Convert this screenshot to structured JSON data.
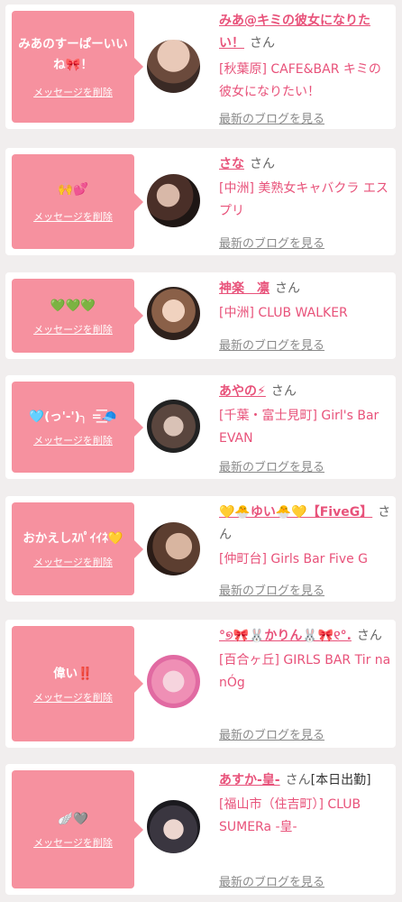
{
  "delete_label": "メッセージを削除",
  "blog_label": "最新のブログを見る",
  "san": "さん",
  "cards": [
    {
      "message": "みあのすーぱーいいね🎀！",
      "name": "みあ@キミの彼女になりたい！",
      "shop": "[秋葉原] CAFE&BAR キミの彼女になりたい！"
    },
    {
      "message": "🙌💕",
      "name": "さな",
      "shop": "[中洲] 美熟女キャバクラ エスプリ"
    },
    {
      "message": "💚💚💚",
      "name": "神楽　凛",
      "shop": "[中洲] CLUB WALKER"
    },
    {
      "message": "🩵(っ'-')╮ =͟͟͞͞🧢",
      "name": "あやの⚡",
      "shop": "[千葉・富士見町] Girl's Bar EVAN"
    },
    {
      "message": "おかえしｽﾊﾟｲｲﾈ💛",
      "name": "💛🐣ゆい🐣💛【FiveG】",
      "shop": "[仲町台] Girls Bar Five G"
    },
    {
      "message_text": "偉い",
      "message_mark": "‼️",
      "name": "°୭🎀🐰かりん🐰🎀୧°.",
      "shop": "[百合ヶ丘] GIRLS BAR Tir na nÓg"
    },
    {
      "message": "🪽🩶",
      "name": "あすか-皇-",
      "name_suffix": "[本日出勤]",
      "shop": "[福山市（住吉町）] CLUB SUMERa -皇-"
    }
  ],
  "colors": {
    "bubble": "#f6919f",
    "accent": "#e8527a",
    "background": "#f1eeee"
  }
}
